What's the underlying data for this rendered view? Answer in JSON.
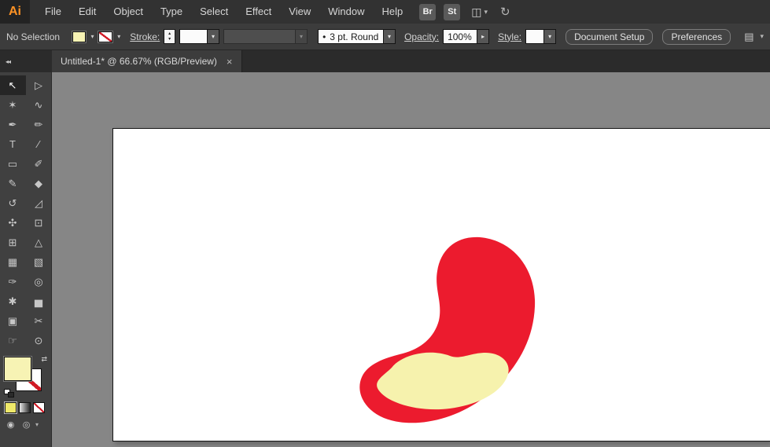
{
  "app": {
    "logo": "Ai",
    "logo_color": "#ff9324"
  },
  "menubar": {
    "items": [
      {
        "label": "File"
      },
      {
        "label": "Edit"
      },
      {
        "label": "Object"
      },
      {
        "label": "Type"
      },
      {
        "label": "Select"
      },
      {
        "label": "Effect"
      },
      {
        "label": "View"
      },
      {
        "label": "Window"
      },
      {
        "label": "Help"
      }
    ],
    "bridge_label": "Br",
    "stock_label": "St"
  },
  "controlbar": {
    "selection_status": "No Selection",
    "stroke_label": "Stroke:",
    "brush_preview": "•",
    "brush_value": "3 pt. Round",
    "opacity_label": "Opacity:",
    "opacity_value": "100%",
    "style_label": "Style:",
    "document_setup_label": "Document Setup",
    "preferences_label": "Preferences"
  },
  "tabbar": {
    "title": "Untitled-1* @ 66.67% (RGB/Preview)",
    "close_glyph": "×",
    "collapse_glyph": "◂◂"
  },
  "toolbar": {
    "tools": [
      {
        "name": "selection-tool",
        "glyph": "↖",
        "selected": true
      },
      {
        "name": "direct-selection-tool",
        "glyph": "▷"
      },
      {
        "name": "magic-wand-tool",
        "glyph": "✶"
      },
      {
        "name": "lasso-tool",
        "glyph": "∿"
      },
      {
        "name": "pen-tool",
        "glyph": "✒"
      },
      {
        "name": "curvature-tool",
        "glyph": "✏"
      },
      {
        "name": "type-tool",
        "glyph": "T"
      },
      {
        "name": "line-segment-tool",
        "glyph": "∕"
      },
      {
        "name": "rectangle-tool",
        "glyph": "▭"
      },
      {
        "name": "paintbrush-tool",
        "glyph": "✐"
      },
      {
        "name": "pencil-tool",
        "glyph": "✎"
      },
      {
        "name": "eraser-tool",
        "glyph": "◆"
      },
      {
        "name": "rotate-tool",
        "glyph": "↺"
      },
      {
        "name": "scale-tool",
        "glyph": "◿"
      },
      {
        "name": "width-tool",
        "glyph": "✣"
      },
      {
        "name": "free-transform-tool",
        "glyph": "⊡"
      },
      {
        "name": "shape-builder-tool",
        "glyph": "⊞"
      },
      {
        "name": "perspective-grid-tool",
        "glyph": "△"
      },
      {
        "name": "mesh-tool",
        "glyph": "▦"
      },
      {
        "name": "gradient-tool",
        "glyph": "▧"
      },
      {
        "name": "eyedropper-tool",
        "glyph": "✑"
      },
      {
        "name": "blend-tool",
        "glyph": "◎"
      },
      {
        "name": "symbol-sprayer-tool",
        "glyph": "✱"
      },
      {
        "name": "column-graph-tool",
        "glyph": "▅"
      },
      {
        "name": "artboard-tool",
        "glyph": "▣"
      },
      {
        "name": "slice-tool",
        "glyph": "✂"
      },
      {
        "name": "hand-tool",
        "glyph": "☞"
      },
      {
        "name": "zoom-tool",
        "glyph": "⊙"
      }
    ],
    "swap_glyph": "⇄",
    "drawing_mode_normal_glyph": "◉",
    "drawing_mode_behind_glyph": "◎"
  },
  "swatches": {
    "fill_color": "#f7f3b4",
    "stroke": "none",
    "mini_color_button": "#efe96a"
  },
  "ui": {
    "chevron": "▾",
    "popup_arrow": "▸",
    "step_up": "▴",
    "step_down": "▾",
    "appbar_icon": "◫",
    "gpu_icon": "↻",
    "arrange_icon": "▤"
  },
  "canvas": {
    "pasteboard_color": "#868686",
    "artboard_color": "#ffffff",
    "shape_red": "#ec1b2e",
    "shape_yellow": "#f6f2ad"
  }
}
